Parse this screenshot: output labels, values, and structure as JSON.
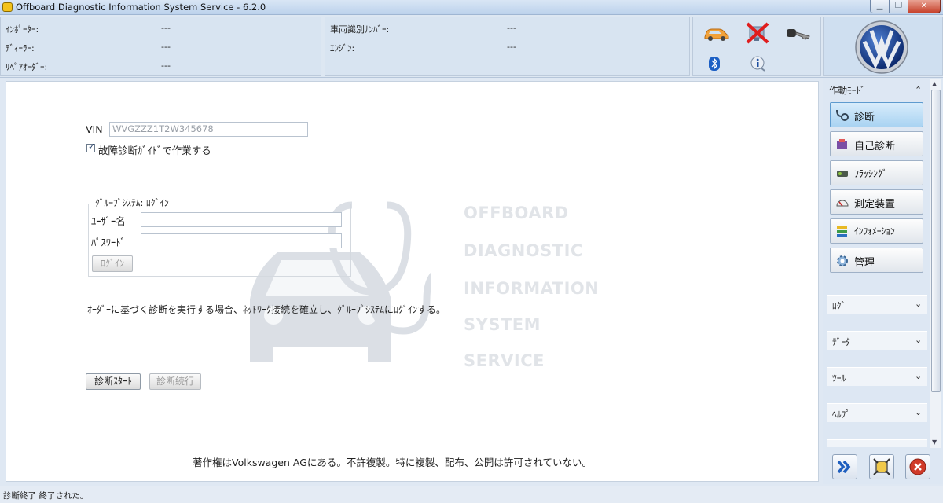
{
  "window": {
    "title": "Offboard Diagnostic Information System Service - 6.2.0"
  },
  "header": {
    "dealer": [
      {
        "label": "ｲﾝﾎﾟｰﾀｰ:",
        "value": "---"
      },
      {
        "label": "ﾃﾞｨｰﾗｰ:",
        "value": "---"
      },
      {
        "label": "ﾘﾍﾟｱｵｰﾀﾞｰ:",
        "value": "---"
      }
    ],
    "vehicle": [
      {
        "label": "車両識別ﾅﾝﾊﾞｰ:",
        "value": "---"
      },
      {
        "label": "ｴﾝｼﾞﾝ:",
        "value": "---"
      }
    ]
  },
  "form": {
    "vin_label": "VIN",
    "vin_placeholder": "WVGZZZ1T2W345678",
    "guided_checkbox_label": "故障診断ｶﾞｲﾄﾞで作業する",
    "group_title": "ｸﾞﾙｰﾌﾟｼｽﾃﾑ: ﾛｸﾞｲﾝ",
    "user_label": "ﾕｰｻﾞｰ名",
    "password_label": "ﾊﾟｽﾜｰﾄﾞ",
    "login_button": "ﾛｸﾞｲﾝ",
    "info_text": "ｵｰﾀﾞｰに基づく診断を実行する場合、ﾈｯﾄﾜｰｸ接続を確立し、ｸﾞﾙｰﾌﾟｼｽﾃﾑにﾛｸﾞｲﾝする。",
    "start_button": "診断ｽﾀｰﾄ",
    "continue_button": "診断続行",
    "copyright": "著作権はVolkswagen AGにある。不許複製。特に複製、配布、公開は許可されていない。"
  },
  "watermark": [
    "OFFBOARD",
    "DIAGNOSTIC",
    "INFORMATION",
    "SYSTEM",
    "SERVICE"
  ],
  "sidebar": {
    "mode_header": "作動ﾓｰﾄﾞ",
    "modes": [
      {
        "label": "診断",
        "active": true
      },
      {
        "label": "自己診断",
        "active": false
      },
      {
        "label": "ﾌﾗｯｼﾝｸﾞ",
        "active": false
      },
      {
        "label": "測定装置",
        "active": false
      },
      {
        "label": "ｲﾝﾌｫﾒｰｼｮﾝ",
        "active": false
      },
      {
        "label": "管理",
        "active": false
      }
    ],
    "sections": [
      "ﾛｸﾞ",
      "ﾃﾞｰﾀ",
      "ﾂｰﾙ",
      "ﾍﾙﾌﾟ"
    ]
  },
  "status": {
    "text": "診断終了 終了された。"
  },
  "colors": {
    "accent": "#5e9bcf",
    "vw_blue": "#1d3f8f",
    "close_red": "#d03a28"
  }
}
